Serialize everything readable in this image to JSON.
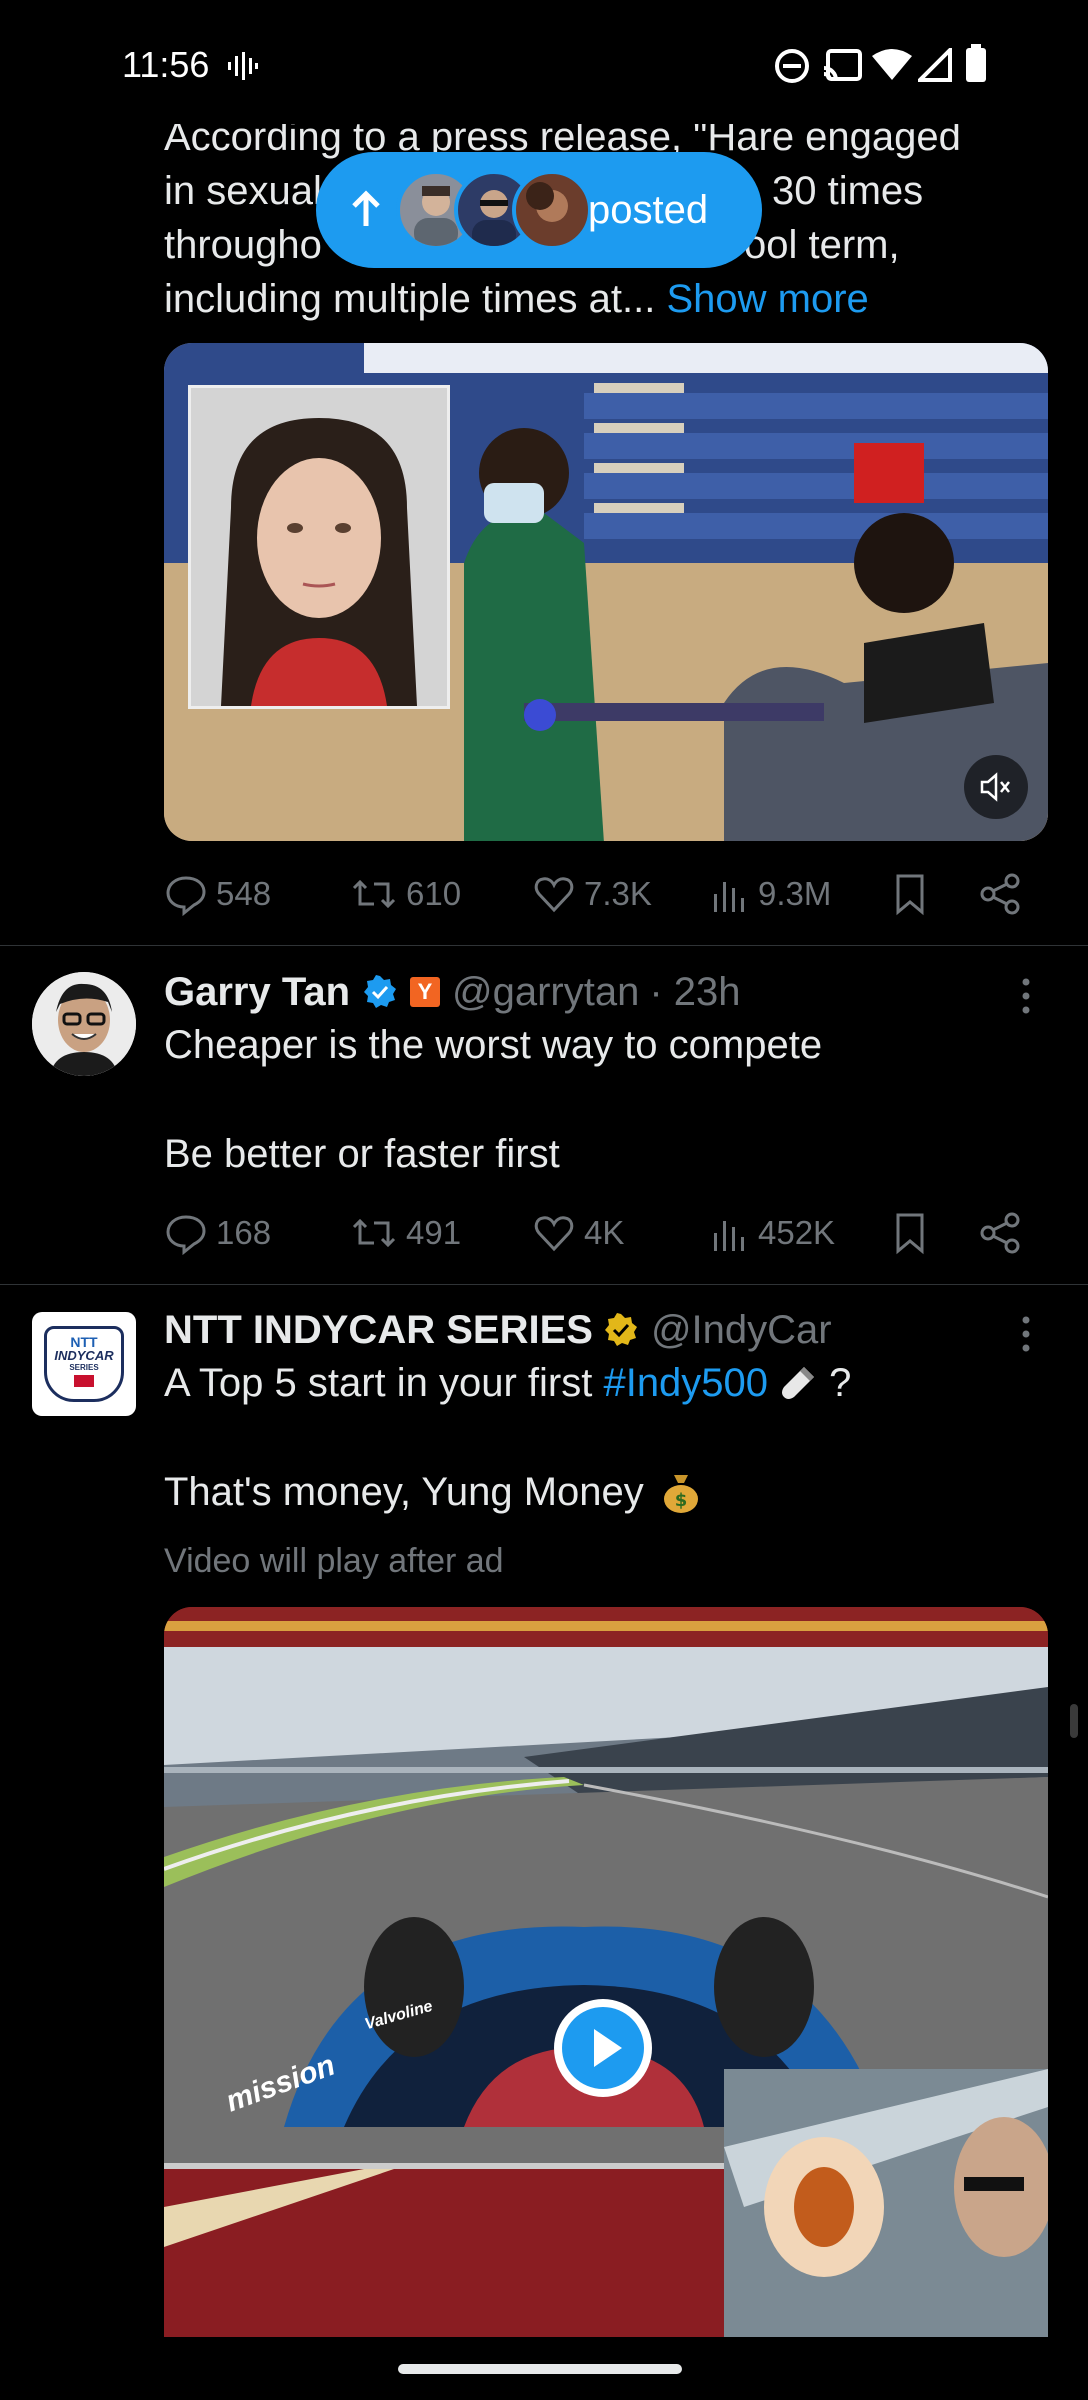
{
  "status_bar": {
    "time": "11:56",
    "icons": [
      "voice-activity-icon",
      "do-not-disturb-icon",
      "cast-icon",
      "wifi-icon",
      "signal-icon",
      "battery-icon"
    ]
  },
  "new_posts_pill": {
    "label": "posted",
    "icon": "arrow-up-icon"
  },
  "tweet1": {
    "text_lines": [
      "According to a press release, \"Hare engaged",
      "in sexual",
      "30 times",
      "througho",
      "ool term,",
      "including multiple times at..."
    ],
    "show_more": "Show more",
    "mute_icon": "mute-icon",
    "stats": {
      "replies": "548",
      "reposts": "610",
      "likes": "7.3K",
      "views": "9.3M"
    }
  },
  "tweet2": {
    "name": "Garry Tan",
    "affiliate_badge": "Y",
    "handle": "@garrytan",
    "time": "· 23h",
    "line1": "Cheaper is the worst way to compete",
    "line2": "Be better or faster first",
    "stats": {
      "replies": "168",
      "reposts": "491",
      "likes": "4K",
      "views": "452K"
    }
  },
  "tweet3": {
    "name": "NTT INDYCAR SERIES",
    "handle": "@IndyCar",
    "line1_prefix": "A Top 5 start in your first ",
    "hashtag": "#Indy500",
    "line1_suffix": " ?",
    "line2": "That's money, Yung Money",
    "video_note": "Video will play after ad",
    "avatar_text": [
      "NTT",
      "INDYCAR",
      "SERIES"
    ],
    "car_text": [
      "mission",
      "Valvoline"
    ]
  },
  "colors": {
    "accent": "#1d9bf0",
    "muted": "#71767b",
    "background": "#000000",
    "gold_badge": "#e2b719"
  }
}
